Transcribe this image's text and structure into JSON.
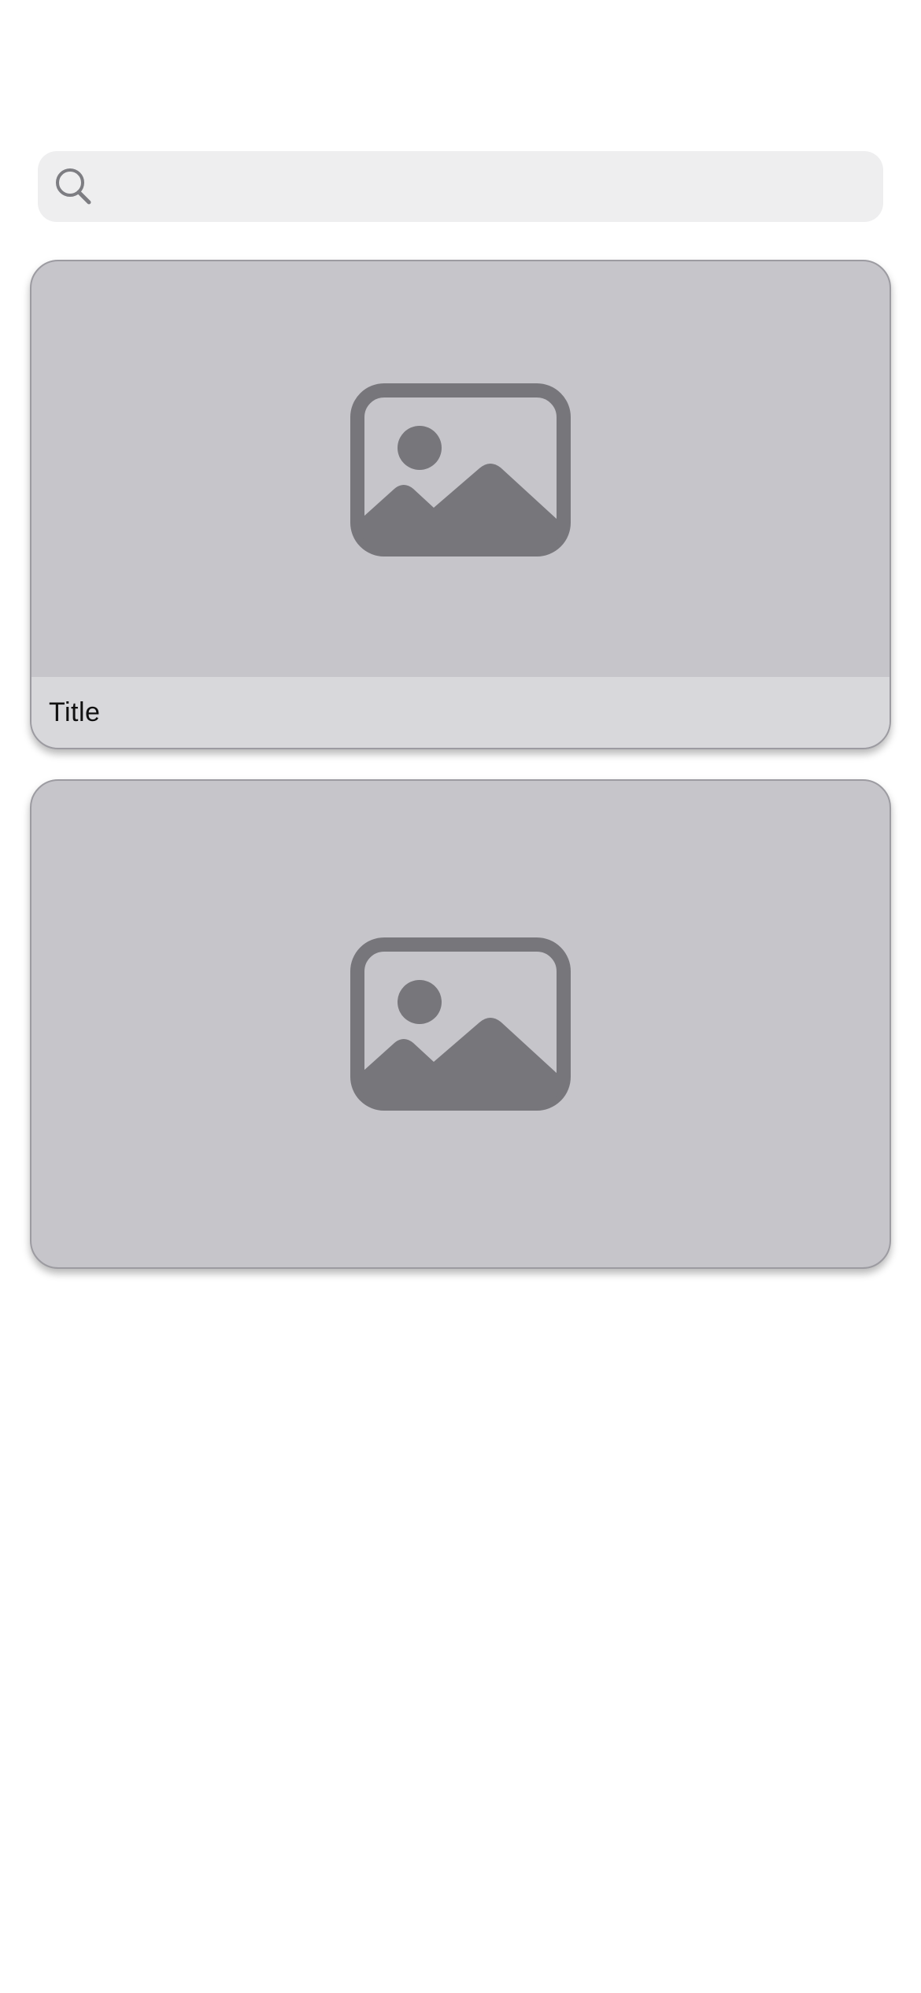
{
  "search": {
    "value": "",
    "placeholder": "",
    "icon": "search-icon"
  },
  "cards": [
    {
      "image_icon": "image-placeholder-icon",
      "title": "Title"
    },
    {
      "image_icon": "image-placeholder-icon"
    }
  ],
  "colors": {
    "background": "#ffffff",
    "search_bg": "#eeeeef",
    "card_bg": "#c6c5ca",
    "caption_bg": "#d8d8db",
    "icon_fill": "#77767b",
    "search_icon": "#7d7d82"
  }
}
